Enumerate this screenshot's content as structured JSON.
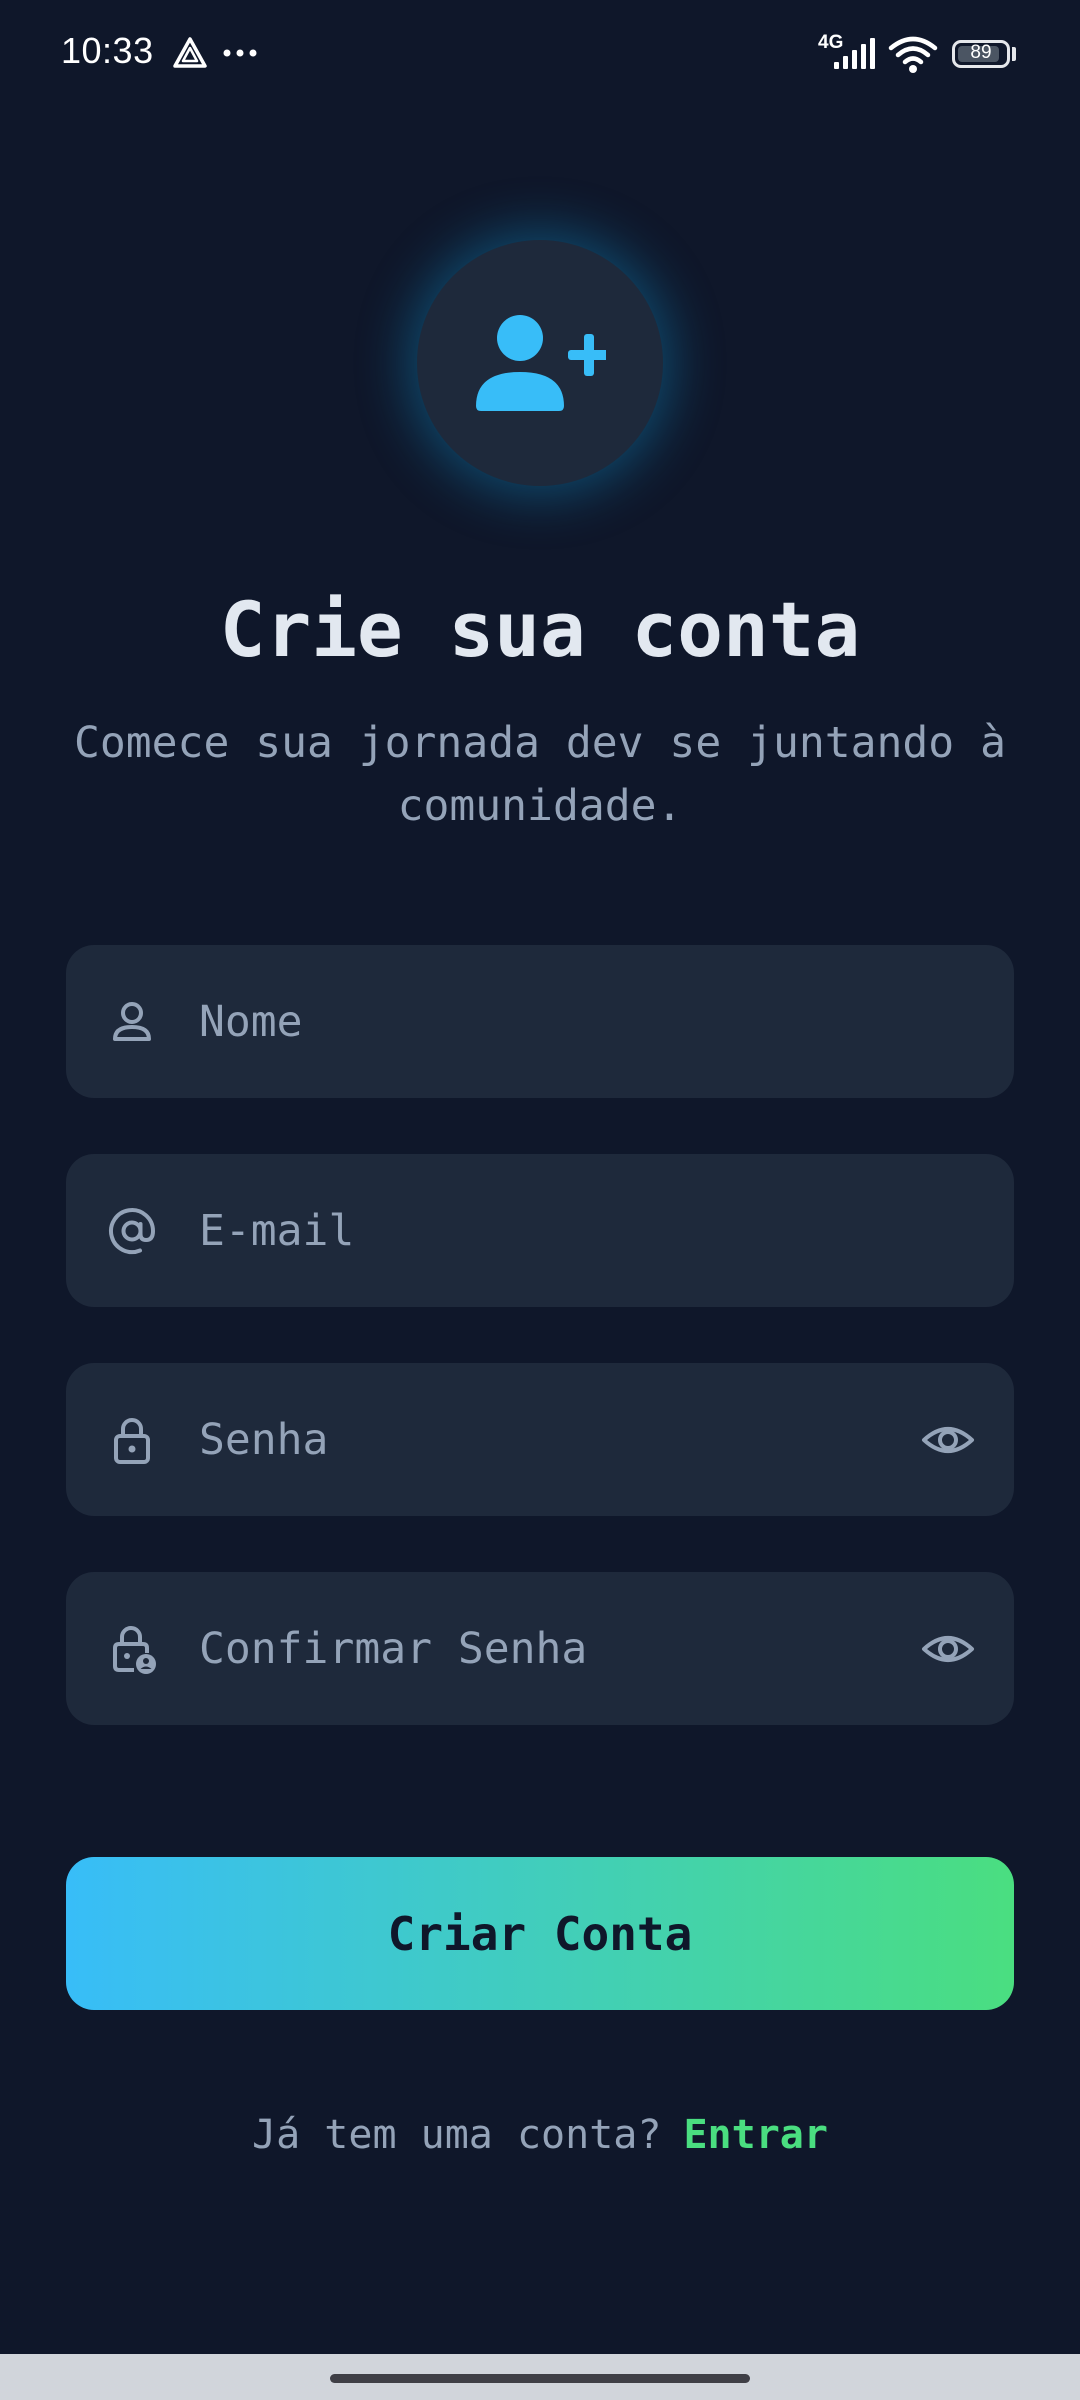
{
  "status_bar": {
    "time": "10:33",
    "network": "4G",
    "battery": "89",
    "battery_level": 0.89
  },
  "header": {
    "title": "Crie sua conta",
    "subtitle": "Comece sua jornada dev se juntando à comunidade."
  },
  "form": {
    "name": {
      "placeholder": "Nome",
      "value": ""
    },
    "email": {
      "placeholder": "E-mail",
      "value": ""
    },
    "password": {
      "placeholder": "Senha",
      "value": ""
    },
    "confirm_password": {
      "placeholder": "Confirmar Senha",
      "value": ""
    }
  },
  "actions": {
    "create_label": "Criar Conta"
  },
  "footer": {
    "prompt": "Já tem uma conta?",
    "login_label": "Entrar"
  },
  "colors": {
    "background": "#0f172a",
    "field": "#1e293b",
    "accent_blue": "#38bdf8",
    "accent_green": "#4ade80",
    "muted_text": "#94a3b8"
  }
}
